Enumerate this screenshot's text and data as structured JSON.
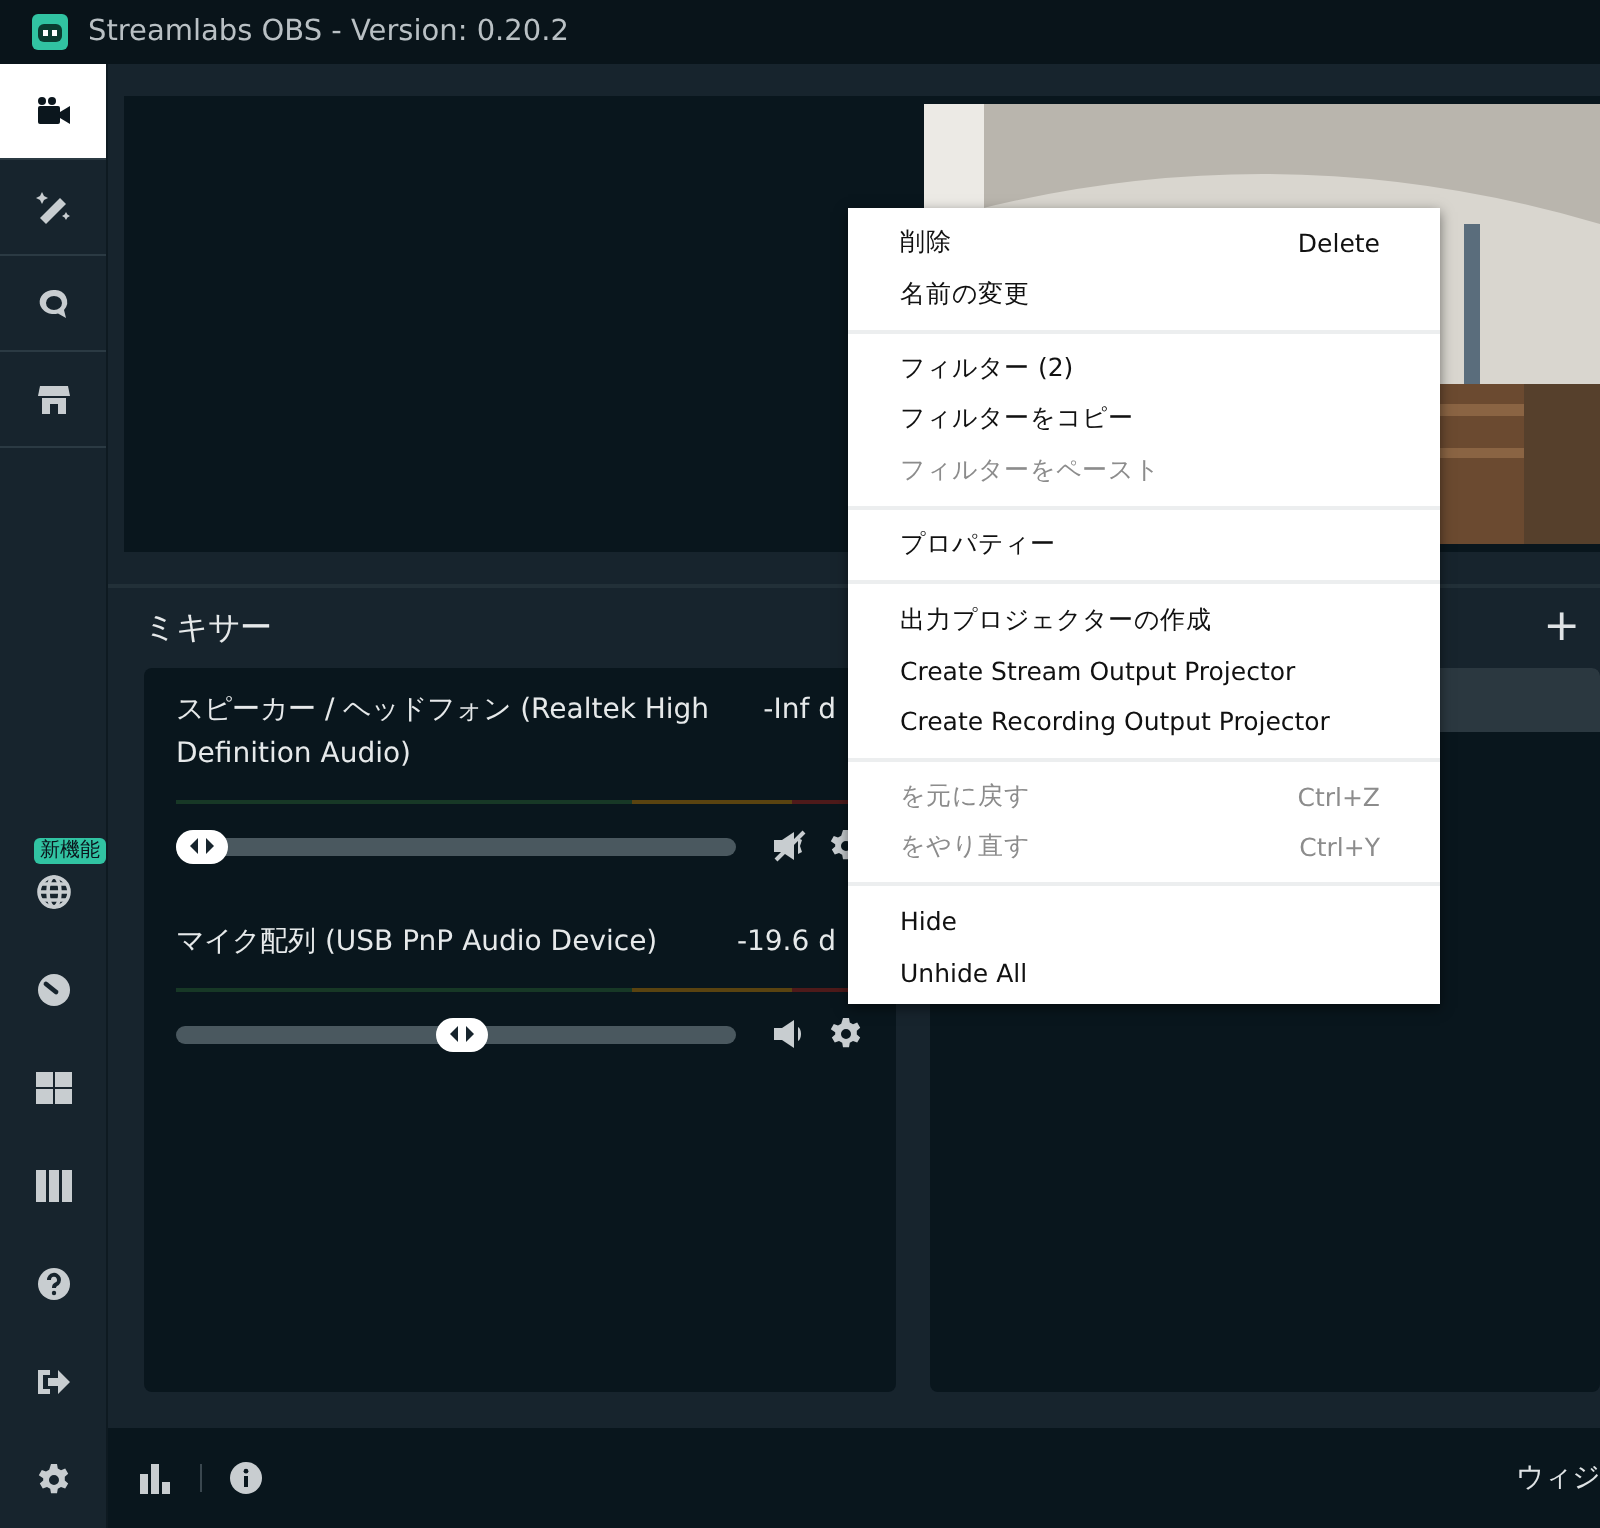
{
  "window": {
    "title": "Streamlabs OBS - Version: 0.20.2"
  },
  "sidebar": {
    "top_items": [
      {
        "selected": true
      },
      {
        "selected": false
      },
      {
        "selected": false
      },
      {
        "selected": false
      }
    ],
    "bottom_items": [
      {
        "selected": false,
        "badge": "新機能"
      },
      {
        "selected": false
      },
      {
        "selected": false
      },
      {
        "selected": false
      },
      {
        "selected": false
      },
      {
        "selected": false
      },
      {
        "selected": false
      }
    ]
  },
  "mixer": {
    "title": "ミキサー",
    "channels": [
      {
        "name": "スピーカー / ヘッドフォン (Realtek High Definition Audio)",
        "reading": "-Inf d",
        "level": 0,
        "muted": true
      },
      {
        "name": "マイク配列 (USB PnP Audio Device)",
        "reading": "-19.6 d",
        "level": 0.51,
        "muted": false
      }
    ]
  },
  "sources": {
    "add_label": "+",
    "rows": [
      {
        "selected": true
      }
    ]
  },
  "context_menu": {
    "groups": [
      [
        {
          "label": "削除",
          "shortcut": "Delete",
          "disabled": false
        },
        {
          "label": "名前の変更",
          "disabled": false
        }
      ],
      [
        {
          "label": "フィルター (2)",
          "disabled": false
        },
        {
          "label": "フィルターをコピー",
          "disabled": false
        },
        {
          "label": "フィルターをペースト",
          "disabled": true
        }
      ],
      [
        {
          "label": "プロパティー",
          "disabled": false
        }
      ],
      [
        {
          "label": "出力プロジェクターの作成",
          "disabled": false
        },
        {
          "label": "Create Stream Output Projector",
          "disabled": false
        },
        {
          "label": "Create Recording Output Projector",
          "disabled": false
        }
      ],
      [
        {
          "label": "を元に戻す",
          "shortcut": "Ctrl+Z",
          "disabled": true
        },
        {
          "label": "をやり直す",
          "shortcut": "Ctrl+Y",
          "disabled": true
        }
      ],
      [
        {
          "label": "Hide",
          "disabled": false
        },
        {
          "label": "Unhide All",
          "disabled": false
        }
      ]
    ]
  },
  "footer": {
    "right_text": "ウィジ"
  }
}
